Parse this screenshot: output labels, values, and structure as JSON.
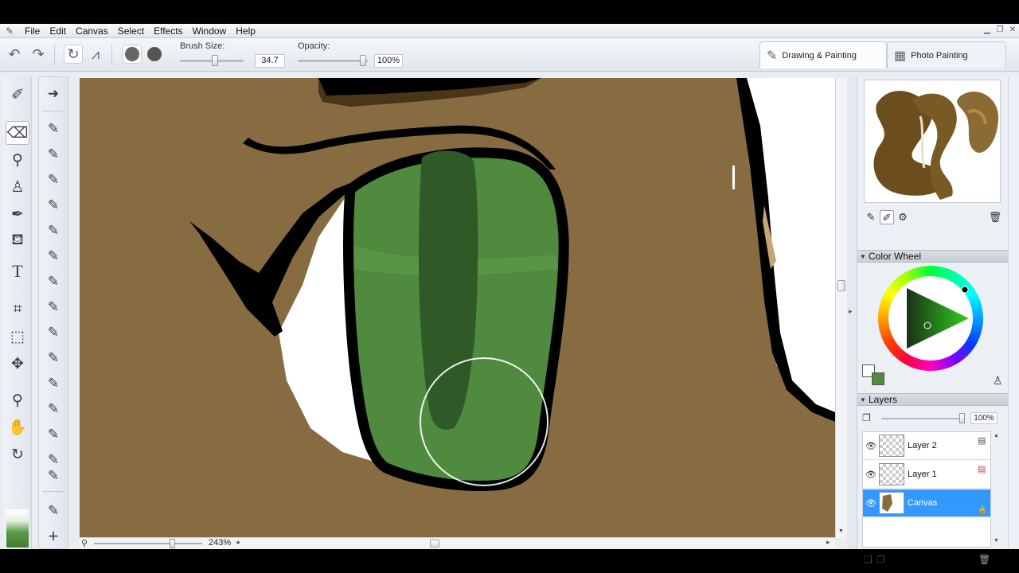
{
  "menu": {
    "items": [
      {
        "key": "file",
        "label": "File"
      },
      {
        "key": "edit",
        "label": "Edit"
      },
      {
        "key": "canvas",
        "label": "Canvas"
      },
      {
        "key": "select",
        "label": "Select"
      },
      {
        "key": "effects",
        "label": "Effects"
      },
      {
        "key": "window",
        "label": "Window"
      },
      {
        "key": "help",
        "label": "Help"
      }
    ]
  },
  "toolbar": {
    "brush_size_label": "Brush Size:",
    "brush_size_value": "34.7",
    "opacity_label": "Opacity:",
    "opacity_value": "100%"
  },
  "mode_tabs": [
    {
      "key": "drawing",
      "label": "Drawing & Painting",
      "active": true
    },
    {
      "key": "photo",
      "label": "Photo Painting",
      "active": false
    }
  ],
  "status": {
    "zoom": "243%"
  },
  "panels": {
    "color_wheel_title": "Color Wheel",
    "layers_title": "Layers",
    "layer_opacity": "100%",
    "colors": {
      "primary": "#4f8a3f",
      "secondary": "#ffffff",
      "canvas_brown": "#876c41",
      "selection_blue": "#3399ff"
    }
  },
  "layers": [
    {
      "name": "Layer 2",
      "selected": false
    },
    {
      "name": "Layer 1",
      "selected": false
    },
    {
      "name": "Canvas",
      "selected": true
    }
  ]
}
